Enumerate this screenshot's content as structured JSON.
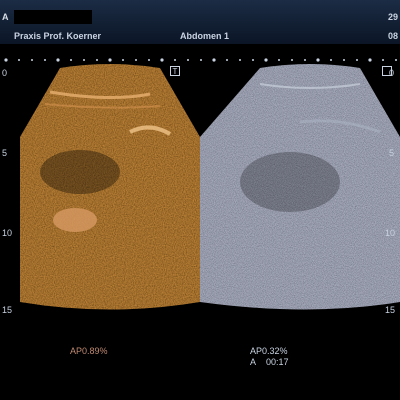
{
  "header": {
    "tag": "A",
    "clinic": "Praxis Prof. Koerner",
    "preset": "Abdomen 1",
    "date_partial": "29",
    "time_partial": "08"
  },
  "left_panel": {
    "marker": "T",
    "depth_ticks": [
      "0",
      "5",
      "10",
      "15"
    ],
    "ap": "AP0.89%"
  },
  "right_panel": {
    "marker": "",
    "depth_ticks": [
      "0",
      "5",
      "10",
      "15"
    ],
    "ap": "AP0.32%",
    "timer_label": "A",
    "timer_value": "00:17"
  },
  "colors": {
    "header_bg": "#152a44",
    "text": "#c9d3e2",
    "contrast_image_tint": "#b5622c",
    "bmode_tint": "#8a96ad"
  }
}
